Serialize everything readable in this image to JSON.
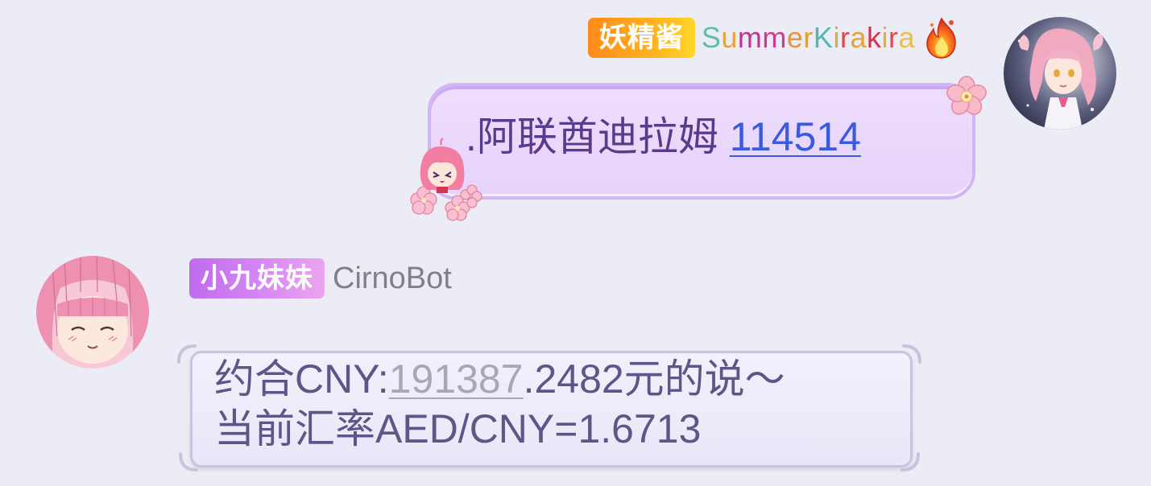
{
  "chat": {
    "messages": [
      {
        "direction": "outgoing",
        "title_badge": "妖精酱",
        "nickname": "SummerKirakira",
        "nickname_color_chars": [
          {
            "ch": "S",
            "color": "#5FBFA0"
          },
          {
            "ch": "u",
            "color": "#E6A43A"
          },
          {
            "ch": "m",
            "color": "#C2338F"
          },
          {
            "ch": "m",
            "color": "#D33A8C"
          },
          {
            "ch": "e",
            "color": "#E9963B"
          },
          {
            "ch": "r",
            "color": "#DDA03E"
          },
          {
            "ch": "K",
            "color": "#52B8B0"
          },
          {
            "ch": "i",
            "color": "#D0B03E"
          },
          {
            "ch": "r",
            "color": "#D74A4A"
          },
          {
            "ch": "a",
            "color": "#E5A33C"
          },
          {
            "ch": "k",
            "color": "#D4334F"
          },
          {
            "ch": "i",
            "color": "#E0B23D"
          },
          {
            "ch": "r",
            "color": "#DE4A4A"
          },
          {
            "ch": "a",
            "color": "#E6C04A"
          }
        ],
        "badge_icon": "fire-icon",
        "text_prefix": ".阿联酋迪拉姆 ",
        "text_link": "114514",
        "avatar": "anime-girl-pink-hair-avatar"
      },
      {
        "direction": "incoming",
        "title_badge": "小九妹妹",
        "nickname": "CirnoBot",
        "line1_prefix": "约合CNY:",
        "line1_underlined": "191387",
        "line1_suffix": ".2482元的说～",
        "line2": "当前汇率AED/CNY=1.6713",
        "avatar": "anime-girl-smiling-avatar"
      }
    ]
  },
  "colors": {
    "background": "#ECECF6",
    "outgoing_bubble": "#E9D8FB",
    "incoming_bubble": "#EFECFA",
    "outgoing_text": "#5B3A8E",
    "incoming_text": "#5D5788",
    "link": "#3A5AE0"
  }
}
